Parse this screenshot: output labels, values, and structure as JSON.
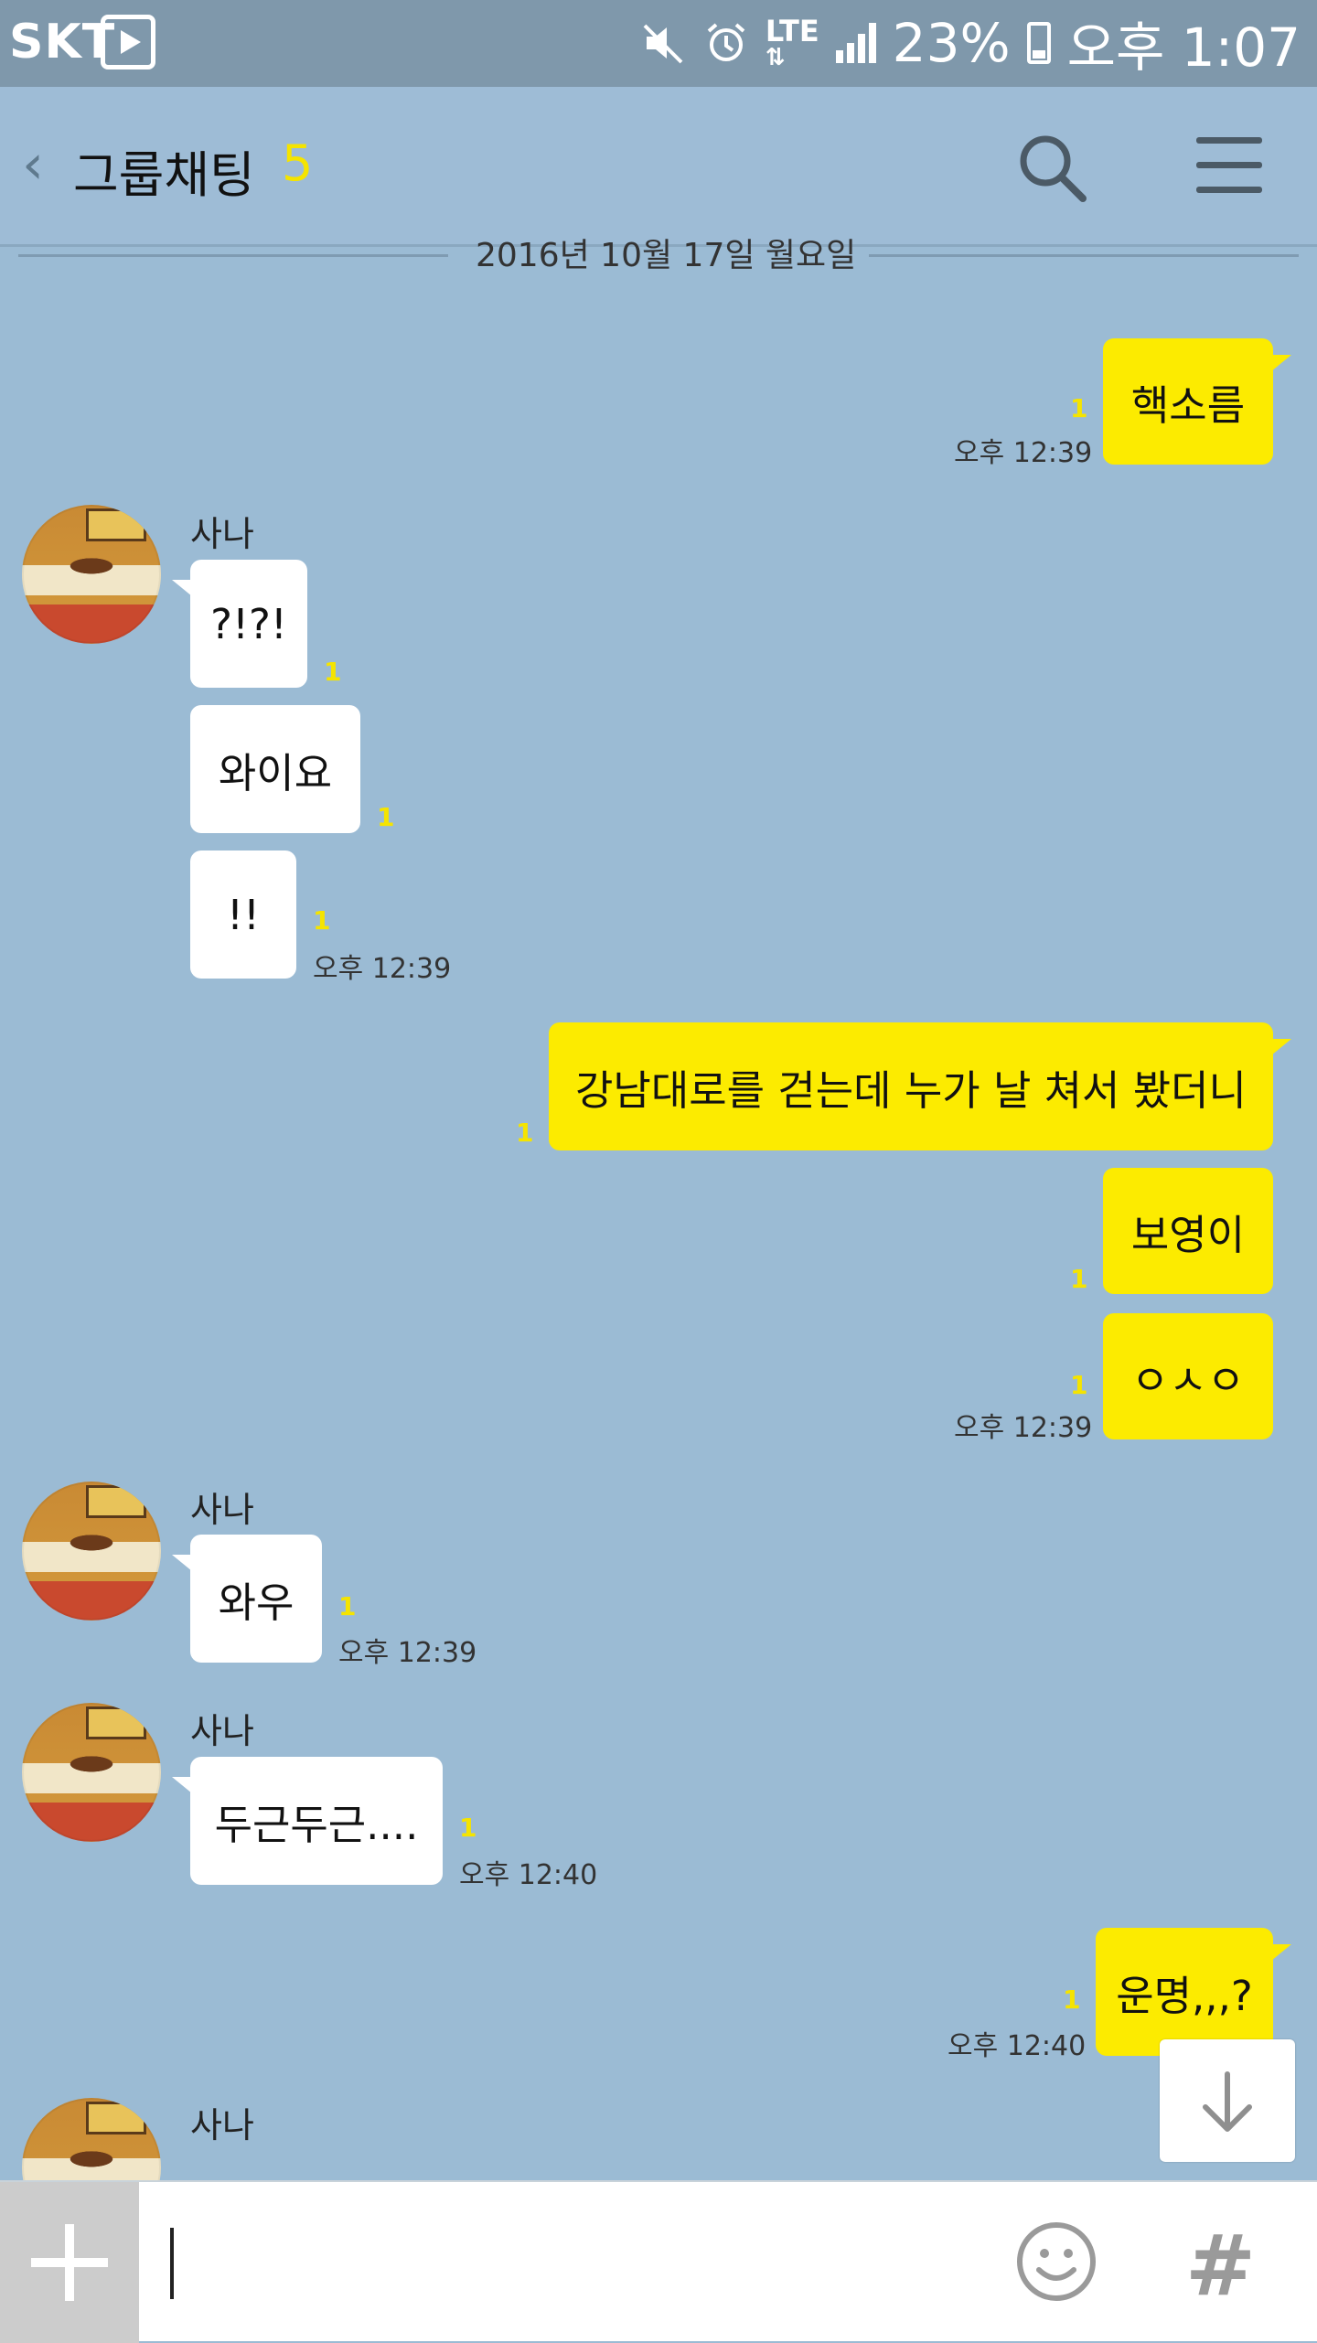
{
  "status_bar": {
    "carrier": "SKT",
    "network": "LTE",
    "battery": "23%",
    "time": "오후 1:07",
    "icons": [
      "play-icon",
      "mute-icon",
      "alarm-icon",
      "lte-icon",
      "signal-icon",
      "battery-icon"
    ]
  },
  "header": {
    "back_icon": "‹",
    "title": "그룹채팅",
    "member_count": "5",
    "icons": [
      "back-icon",
      "search-icon",
      "menu-icon"
    ]
  },
  "date_divider": "2016년 10월 17일 월요일",
  "messages": [
    {
      "side": "me",
      "text": "핵소름",
      "unread": "1",
      "time": "오후 12:39"
    },
    {
      "side": "them",
      "sender": "사나",
      "text": "?!?!",
      "unread": "1"
    },
    {
      "side": "them",
      "text": "와이요",
      "unread": "1"
    },
    {
      "side": "them",
      "text": "!!",
      "unread": "1",
      "time": "오후 12:39"
    },
    {
      "side": "me",
      "text": "강남대로를 걷는데 누가 날 쳐서 봤더니",
      "unread": "1"
    },
    {
      "side": "me",
      "text": "보영이",
      "unread": "1"
    },
    {
      "side": "me",
      "text": "ㅇㅅㅇ",
      "unread": "1",
      "time": "오후 12:39"
    },
    {
      "side": "them",
      "sender": "사나",
      "text": "와우",
      "unread": "1",
      "time": "오후 12:39"
    },
    {
      "side": "them",
      "sender": "사나",
      "text": "두근두근....",
      "unread": "1",
      "time": "오후 12:40"
    },
    {
      "side": "me",
      "text": "운명,,,?",
      "unread": "1",
      "time": "오후 12:40"
    },
    {
      "side": "them",
      "sender": "사나"
    }
  ],
  "input_bar": {
    "placeholder": "",
    "hash_label": "#",
    "icons": [
      "plus-icon",
      "emoji-icon",
      "hash-icon"
    ]
  },
  "colors": {
    "background": "#9bbbd4",
    "my_bubble": "#fceb00",
    "their_bubble": "#ffffff",
    "unread": "#f5e400"
  }
}
